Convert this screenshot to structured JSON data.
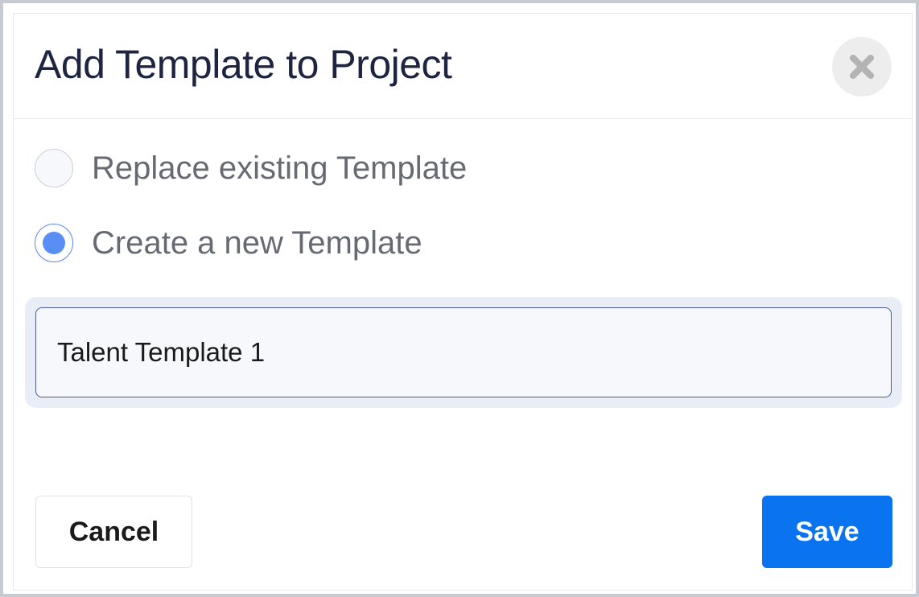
{
  "dialog": {
    "title": "Add Template to Project",
    "close_icon": "close-icon"
  },
  "options": [
    {
      "label": "Replace existing Template",
      "checked": false
    },
    {
      "label": "Create a new Template",
      "checked": true
    }
  ],
  "template_name": {
    "value": "Talent Template 1"
  },
  "actions": {
    "cancel_label": "Cancel",
    "save_label": "Save"
  },
  "colors": {
    "title_text": "#1d2540",
    "radio_selected": "#5b8ef4",
    "input_border": "#4a5aa5",
    "save_button": "#0a74f0",
    "close_button_bg": "#ededed"
  }
}
